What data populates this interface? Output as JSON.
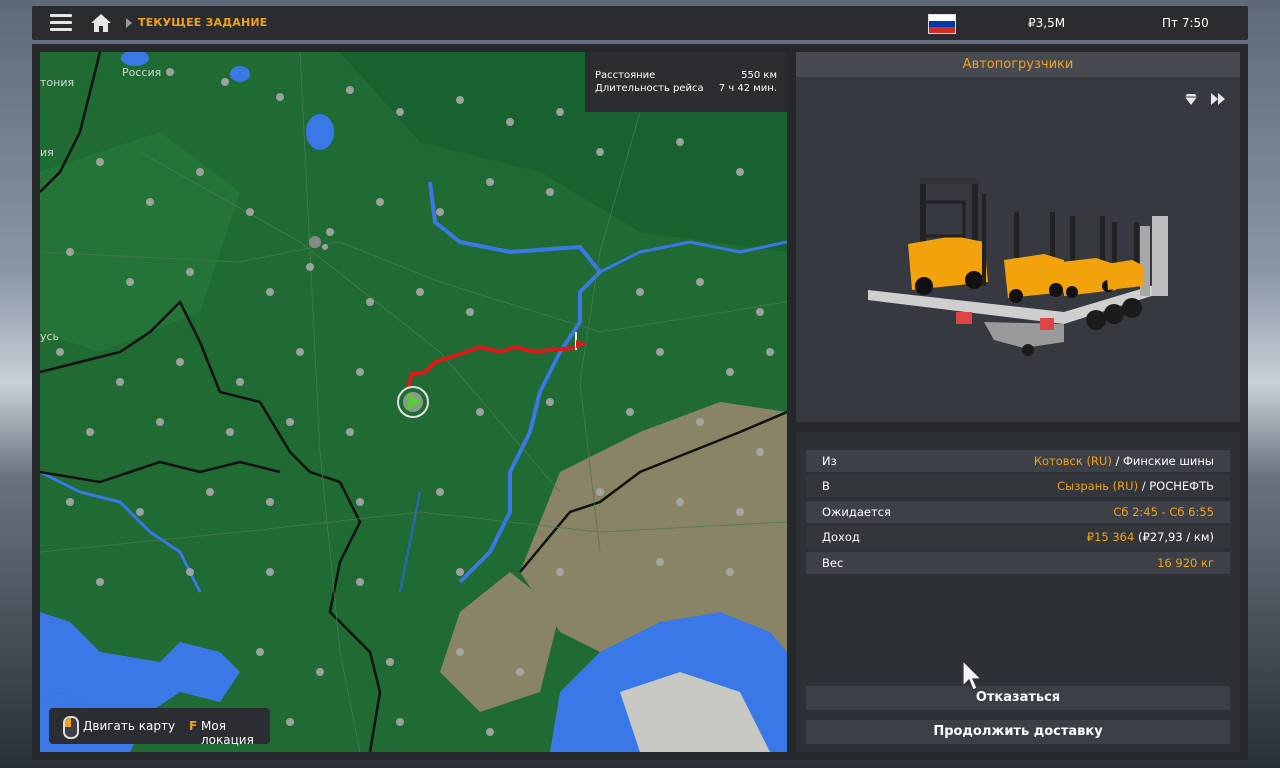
{
  "topbar": {
    "breadcrumb": "ТЕКУЩЕЕ ЗАДАНИЕ",
    "money": "₽3,5M",
    "time": "Пт 7:50",
    "icons": [
      "menu-icon",
      "home-icon",
      "flag-icon"
    ],
    "flag_colors": [
      "#ffffff",
      "#0039a6",
      "#d52b1e"
    ]
  },
  "map": {
    "labels": [
      "Россия",
      "тония",
      "ия",
      "усь"
    ],
    "route_color": "#d91a1a",
    "distance_label": "Расстояние",
    "distance_value": "550 км",
    "duration_label": "Длительность рейса",
    "duration_value": "7 ч 42 мин.",
    "controls": {
      "move_label": "Двигать карту",
      "key": "F",
      "locate_label": "Моя локация"
    }
  },
  "cargo": {
    "title": "Автопогрузчики",
    "icons": [
      "diamond-icon",
      "fast-forward-icon"
    ]
  },
  "details": {
    "rows": [
      {
        "label": "Из",
        "value_highlight": "Котовск (RU)",
        "value_rest": " / Финские шины"
      },
      {
        "label": "В",
        "value_highlight": "Сызрань (RU)",
        "value_rest": " / РОСНЕФТЬ"
      },
      {
        "label": "Ожидается",
        "value_highlight": "Сб 2:45 - Сб 6:55",
        "value_rest": ""
      },
      {
        "label": "Доход",
        "value_highlight": "₽15 364",
        "value_rest": " (₽27,93 / км)"
      },
      {
        "label": "Вес",
        "value_highlight": "16 920 кг",
        "value_rest": ""
      }
    ]
  },
  "buttons": {
    "decline": "Отказаться",
    "continue": "Продолжить доставку"
  },
  "colors": {
    "accent": "#f0a21c",
    "map_land": "#1f6b33",
    "water": "#3a78e8",
    "steppe": "#8a8466"
  }
}
